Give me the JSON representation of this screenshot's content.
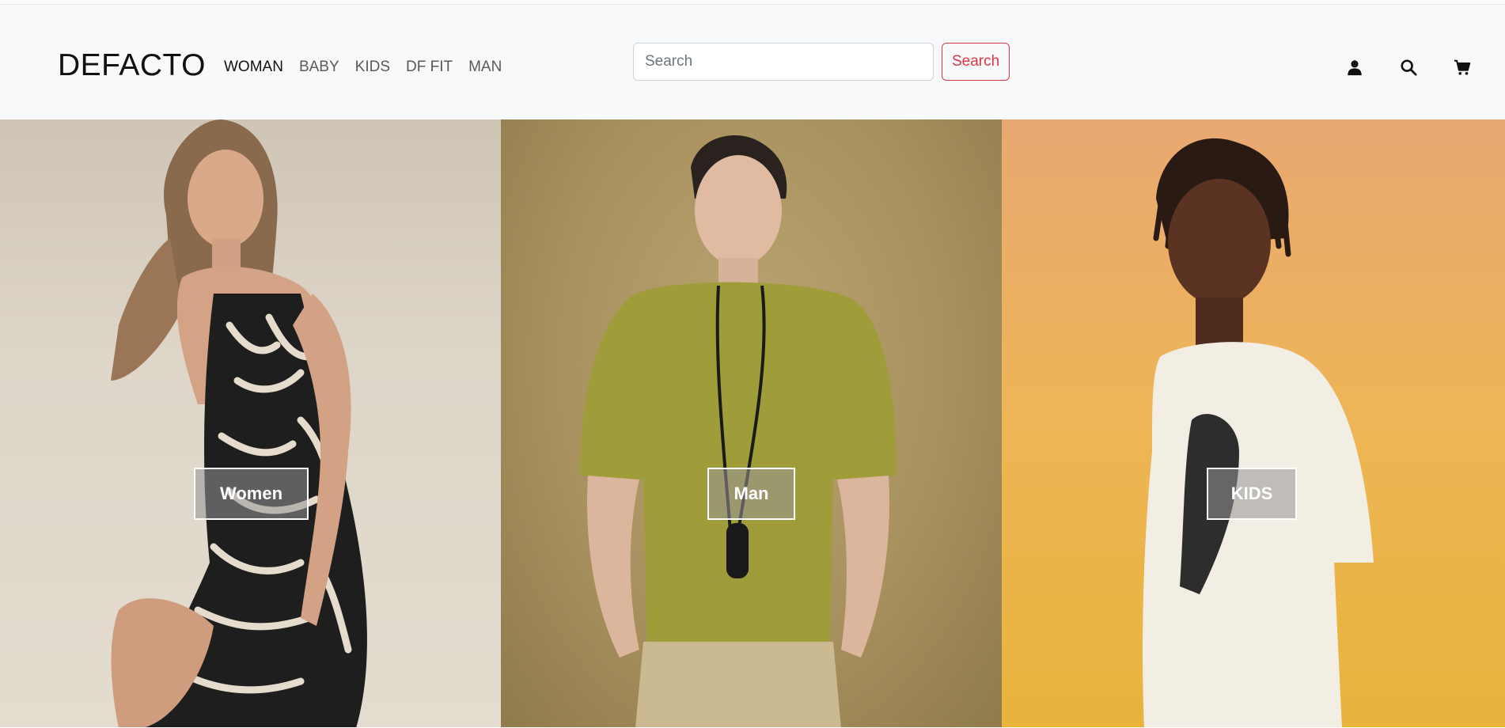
{
  "brand": "DEFACTO",
  "nav": {
    "links": [
      {
        "label": "WOMAN",
        "active": true
      },
      {
        "label": "BABY",
        "active": false
      },
      {
        "label": "KIDS",
        "active": false
      },
      {
        "label": "DF FIT",
        "active": false
      },
      {
        "label": "MAN",
        "active": false
      }
    ]
  },
  "search": {
    "placeholder": "Search",
    "value": "",
    "button_label": "Search"
  },
  "icons": [
    "user-icon",
    "search-icon",
    "cart-icon"
  ],
  "categories": [
    {
      "label": "Women"
    },
    {
      "label": "Man"
    },
    {
      "label": "KIDS"
    }
  ],
  "colors": {
    "navbar_bg": "#f8f9fa",
    "accent": "#dc3545"
  }
}
